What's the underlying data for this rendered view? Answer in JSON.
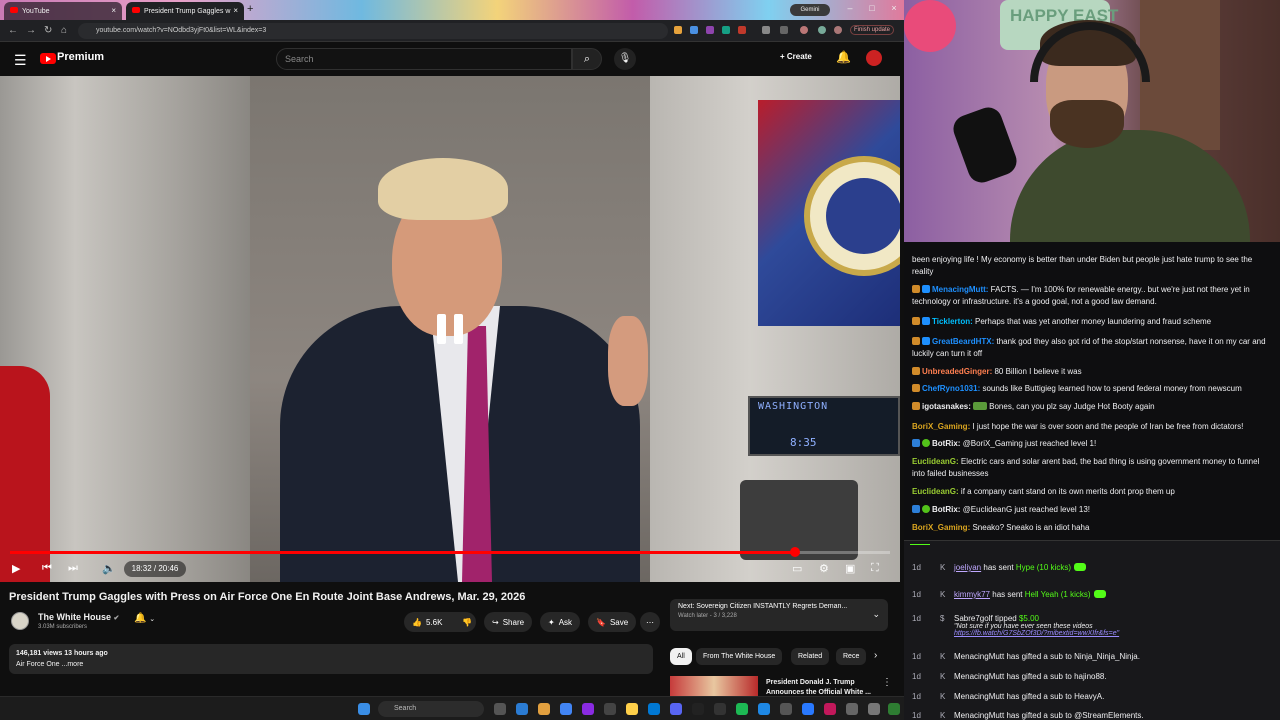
{
  "browser": {
    "tabs": [
      {
        "label": "YouTube"
      },
      {
        "label": "President Trump Gaggles w"
      }
    ],
    "gemini_label": "Gemini",
    "url": "youtube.com/watch?v=NOdbd3yjFt0&list=WL&index=3",
    "finish_update": "Finish update"
  },
  "youtube": {
    "brand": "Premium",
    "search_placeholder": "Search",
    "create_label": "Create",
    "video": {
      "title": "President Trump Gaggles with Press on Air Force One En Route Joint Base Andrews, Mar. 29, 2026",
      "current_time": "18:32",
      "duration": "20:46",
      "time_display": "18:32 / 20:46",
      "progress_fraction": 0.892,
      "screen_text_city": "WASHINGTON",
      "screen_text_time": "8:35"
    },
    "channel": {
      "name": "The White House",
      "subscribers": "3.03M subscribers"
    },
    "actions": {
      "likes": "5.6K",
      "share": "Share",
      "ask": "Ask",
      "save": "Save"
    },
    "description": {
      "stats": "146,181 views  13 hours ago",
      "text": "Air Force One ...more"
    },
    "next": {
      "title": "Next: Sovereign Citizen INSTANTLY Regrets Deman...",
      "sub": "Watch later - 3 / 3,228"
    },
    "chips": [
      "All",
      "From The White House",
      "Related",
      "Rece"
    ],
    "recommended": {
      "title": "President Donald J. Trump Announces the Official White ..."
    }
  },
  "taskbar": {
    "search_placeholder": "Search"
  },
  "overlay": {
    "sign_text": "HAPPY EAST"
  },
  "chat": {
    "messages": [
      {
        "user": "",
        "text": "been enjoying life ! My economy is better than under Biden but people just hate trump to see the reality",
        "color": "#efeff1"
      },
      {
        "user": "MenacingMutt:",
        "text": "FACTS. — I'm 100% for renewable energy.. but we're just not there yet in technology or infrastructure. it's a good goal, not a good law demand.",
        "color": "#1e90ff"
      },
      {
        "user": "Ticklerton:",
        "text": "Perhaps that was yet another money laundering and fraud scheme",
        "color": "#00bfff"
      },
      {
        "user": "GreatBeardHTX:",
        "text": "thank god they also got rid of the stop/start nonsense, have it on my car and luckily can turn it off",
        "color": "#1e90ff"
      },
      {
        "user": "UnbreadedGinger:",
        "text": "80 Billion I believe it was",
        "color": "#ff7f50"
      },
      {
        "user": "ChefRyno1031:",
        "text": "sounds like Buttigieg learned how to spend federal money from newscum",
        "color": "#1e90ff"
      },
      {
        "user": "igotasnakes:",
        "text": "Bones, can you plz say Judge Hot Booty again",
        "color": "#efeff1"
      },
      {
        "user": "BoriX_Gaming:",
        "text": "I just hope the war is over soon and the people of Iran be free from dictators!",
        "color": "#daa520"
      },
      {
        "user": "BotRix:",
        "text": "@BoriX_Gaming just reached level 1!",
        "color": "#efeff1"
      },
      {
        "user": "EuclideanG:",
        "text": "Electric cars and solar arent bad, the bad thing is using government money to funnel into failed businesses",
        "color": "#9acd32"
      },
      {
        "user": "EuclideanG:",
        "text": "if a company cant stand on its own merits dont prop them up",
        "color": "#9acd32"
      },
      {
        "user": "BotRix:",
        "text": "@EuclideanG just reached level 13!",
        "color": "#efeff1"
      },
      {
        "user": "BoriX_Gaming:",
        "text": "Sneako? Sneako is an idiot haha",
        "color": "#daa520"
      }
    ]
  },
  "events": [
    {
      "time": "1d",
      "name": "joeliyan",
      "text": "has sent",
      "extra": "Hype (10 kicks)"
    },
    {
      "time": "1d",
      "name": "kimmyk77",
      "text": "has sent",
      "extra": "Hell Yeah (1 kicks)"
    },
    {
      "time": "1d",
      "name": "Sabre7golf",
      "text": "tipped",
      "extra": "$5.00",
      "note": "\"Not sure if you have ever seen these videos",
      "link": "https://fb.watch/G7SbZOf3D/?mibextid=wwXIfr&fs=e\""
    },
    {
      "time": "1d",
      "name": "MenacingMutt",
      "text": "has gifted a sub to",
      "extra": "Ninja_Ninja_Ninja."
    },
    {
      "time": "1d",
      "name": "MenacingMutt",
      "text": "has gifted a sub to",
      "extra": "hajino88."
    },
    {
      "time": "1d",
      "name": "MenacingMutt",
      "text": "has gifted a sub to",
      "extra": "HeavyA."
    },
    {
      "time": "1d",
      "name": "MenacingMutt",
      "text": "has gifted a sub to",
      "extra": "@StreamElements."
    }
  ]
}
